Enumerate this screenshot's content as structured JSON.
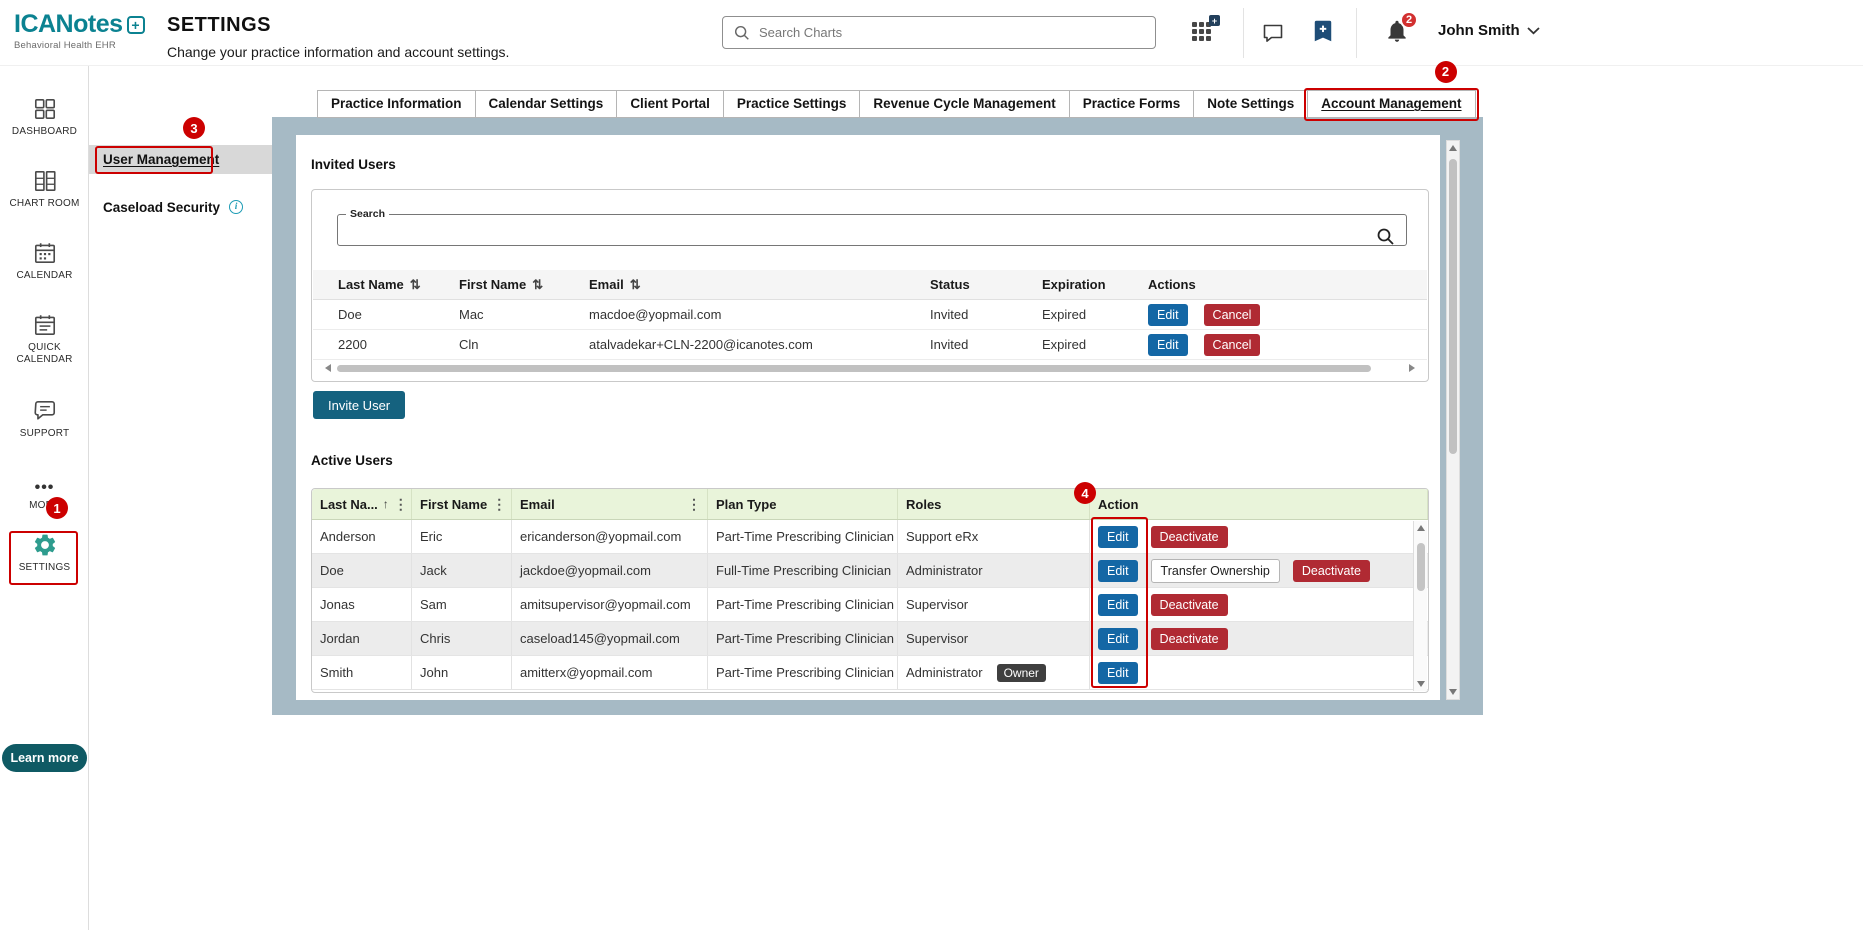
{
  "header": {
    "logo_name": "ICANotes",
    "logo_subtitle": "Behavioral Health EHR",
    "page_title": "SETTINGS",
    "page_subtitle": "Change your practice information and account settings.",
    "search_placeholder": "Search Charts",
    "bell_badge": "2",
    "user_name": "John Smith"
  },
  "sidebar": {
    "items": [
      {
        "label": "DASHBOARD"
      },
      {
        "label": "CHART ROOM"
      },
      {
        "label": "CALENDAR"
      },
      {
        "label": "QUICK CALENDAR"
      },
      {
        "label": "SUPPORT"
      },
      {
        "label": "MORE"
      },
      {
        "label": "SETTINGS"
      }
    ],
    "learn_more": "Learn more"
  },
  "subnav": {
    "user_management": "User Management",
    "caseload_security": "Caseload Security"
  },
  "tabs": [
    "Practice Information",
    "Calendar Settings",
    "Client Portal",
    "Practice Settings",
    "Revenue Cycle Management",
    "Practice Forms",
    "Note Settings",
    "Account Management"
  ],
  "active_tab": "Account Management",
  "invited": {
    "title": "Invited Users",
    "search_label": "Search",
    "columns": [
      "Last Name",
      "First Name",
      "Email",
      "Status",
      "Expiration",
      "Actions"
    ],
    "rows": [
      {
        "last": "Doe",
        "first": "Mac",
        "email": "macdoe@yopmail.com",
        "status": "Invited",
        "expiration": "Expired",
        "actions": [
          "Edit",
          "Cancel"
        ]
      },
      {
        "last": "2200",
        "first": "Cln",
        "email": "atalvadekar+CLN-2200@icanotes.com",
        "status": "Invited",
        "expiration": "Expired",
        "actions": [
          "Edit",
          "Cancel"
        ]
      }
    ],
    "invite_button": "Invite User"
  },
  "active": {
    "title": "Active Users",
    "columns": [
      "Last Na...",
      "First Name",
      "Email",
      "Plan Type",
      "Roles",
      "Action"
    ],
    "rows": [
      {
        "last": "Anderson",
        "first": "Eric",
        "email": "ericanderson@yopmail.com",
        "plan": "Part-Time Prescribing Clinician",
        "roles": "Support eRx",
        "actions": [
          "Edit",
          "Deactivate"
        ]
      },
      {
        "last": "Doe",
        "first": "Jack",
        "email": "jackdoe@yopmail.com",
        "plan": "Full-Time Prescribing Clinician",
        "roles": "Administrator",
        "actions": [
          "Edit",
          "Transfer Ownership",
          "Deactivate"
        ]
      },
      {
        "last": "Jonas",
        "first": "Sam",
        "email": "amitsupervisor@yopmail.com",
        "plan": "Part-Time Prescribing Clinician",
        "roles": "Supervisor",
        "actions": [
          "Edit",
          "Deactivate"
        ]
      },
      {
        "last": "Jordan",
        "first": "Chris",
        "email": "caseload145@yopmail.com",
        "plan": "Part-Time Prescribing Clinician",
        "roles": "Supervisor",
        "actions": [
          "Edit",
          "Deactivate"
        ]
      },
      {
        "last": "Smith",
        "first": "John",
        "email": "amitterx@yopmail.com",
        "plan": "Part-Time Prescribing Clinician",
        "roles": "Administrator",
        "owner": "Owner",
        "actions": [
          "Edit"
        ]
      }
    ]
  },
  "annotations": {
    "s1": "1",
    "s2": "2",
    "s3": "3",
    "s4": "4"
  },
  "icons": {
    "sort_both": "⇅",
    "sort_asc": "↑",
    "kebab": "⋮",
    "more_dots": "•••",
    "info": "i",
    "plus": "+",
    "logo_plus": "+"
  },
  "colors": {
    "accent_teal": "#0b8291",
    "button_blue": "#1467a5",
    "button_red": "#b02a33",
    "invite_button": "#15627f",
    "annotation_red": "#cc0000",
    "table_header_green": "#e9f4da",
    "panel_background": "#a6bac5",
    "gear_green": "#2e9c8e",
    "owner_badge": "#3f3f3f",
    "learn_more": "#0f5a64"
  }
}
